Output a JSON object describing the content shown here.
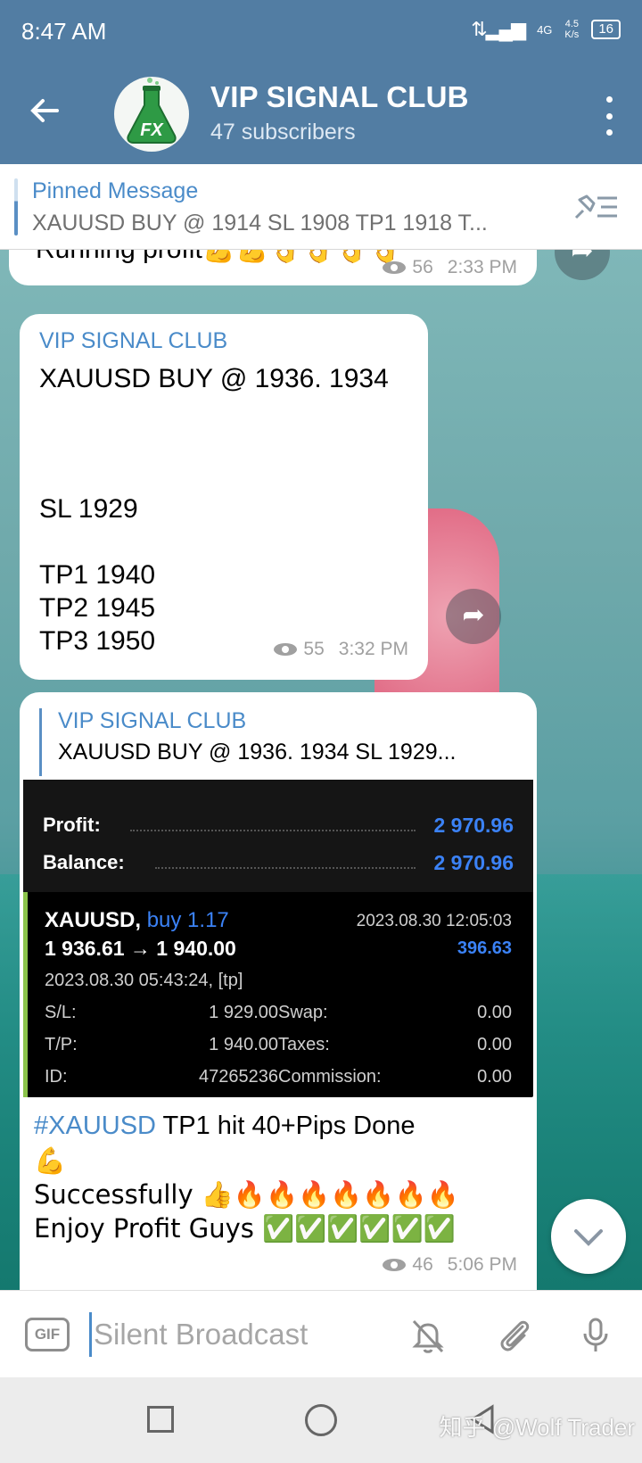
{
  "status_bar": {
    "time": "8:47 AM",
    "network": "4G",
    "speed_value": "4.5",
    "speed_unit": "K/s",
    "battery": "16"
  },
  "header": {
    "title": "VIP SIGNAL CLUB",
    "subtitle": "47 subscribers",
    "avatar_text": "FX"
  },
  "pinned": {
    "title": "Pinned Message",
    "text": "XAUUSD BUY @ 1914     SL 1908  TP1 1918 T..."
  },
  "messages": {
    "m1": {
      "text": "Running profit💪💪👌👌👌👌",
      "views": "56",
      "time": "2:33 PM"
    },
    "m2": {
      "sender": "VIP SIGNAL CLUB",
      "line1": "XAUUSD BUY @ 1936.  1934",
      "sl": "SL 1929",
      "tp1": "TP1 1940",
      "tp2": "TP2 1945",
      "tp3": "TP3 1950",
      "views": "55",
      "time": "3:32 PM"
    },
    "m3": {
      "reply_name": "VIP SIGNAL CLUB",
      "reply_text": "XAUUSD BUY @ 1936.  1934    SL 1929...",
      "screenshot": {
        "profit_label": "Profit:",
        "profit_value": "2 970.96",
        "balance_label": "Balance:",
        "balance_value": "2 970.96",
        "symbol": "XAUUSD,",
        "side": "buy 1.17",
        "close_time": "2023.08.30 12:05:03",
        "prices": "1 936.61 → 1 940.00",
        "pl": "396.63",
        "open_time": "2023.08.30 05:43:24, [tp]",
        "sl_label": "S/L:",
        "sl_value": "1 929.00",
        "tp_label": "T/P:",
        "tp_value": "1 940.00",
        "id_label": "ID:",
        "id_value": "47265236",
        "swap_label": "Swap:",
        "swap_value": "0.00",
        "taxes_label": "Taxes:",
        "taxes_value": "0.00",
        "commission_label": "Commission:",
        "commission_value": "0.00"
      },
      "hashtag": "#XAUUSD",
      "line1_rest": " TP1 hit 40+Pips Done",
      "line2": "💪",
      "line3": "Successfully 👍🔥🔥🔥🔥🔥🔥🔥",
      "line4": "Enjoy Profit Guys ✅✅✅✅✅✅",
      "views": "46",
      "time": "5:06 PM"
    }
  },
  "input": {
    "gif_label": "GIF",
    "placeholder": "Silent Broadcast"
  },
  "watermark": "知乎 @Wolf Trader",
  "colors": {
    "header": "#527da3",
    "accent": "#4a8bc9",
    "profit_blue": "#3b82f6"
  }
}
